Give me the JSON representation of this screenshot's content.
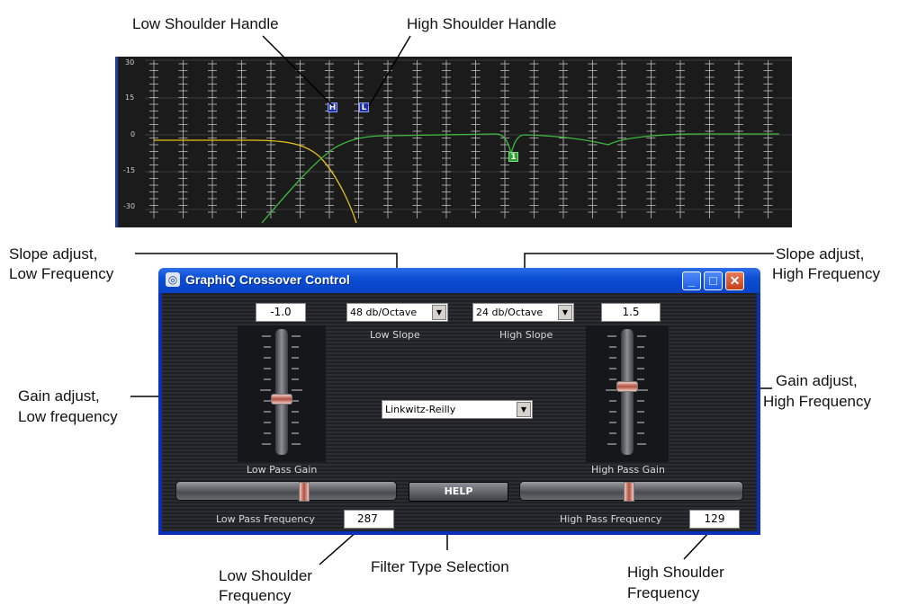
{
  "annotations": {
    "low_shoulder_handle": "Low Shoulder Handle",
    "high_shoulder_handle": "High Shoulder Handle",
    "slope_low_1": "Slope adjust,",
    "slope_low_2": "Low  Frequency",
    "slope_high_1": "Slope adjust,",
    "slope_high_2": "High  Frequency",
    "gain_low_1": "Gain adjust,",
    "gain_low_2": "Low  frequency",
    "gain_high_1": "Gain adjust,",
    "gain_high_2": "High  Frequency",
    "low_shoulder_freq_1": "Low Shoulder",
    "low_shoulder_freq_2": "Frequency",
    "filter_type": "Filter Type Selection",
    "high_shoulder_freq_1": "High Shoulder",
    "high_shoulder_freq_2": "Frequency"
  },
  "graph": {
    "y_labels": [
      "30",
      "15",
      "0",
      "-15",
      "-30"
    ],
    "handle_low": "H",
    "handle_high": "L",
    "marker_green": "1",
    "colors": {
      "background": "#1b1b1b",
      "grid": "#bdbdbd",
      "low_curve": "#e6c21a",
      "high_curve": "#3fb83f"
    }
  },
  "window": {
    "title": "GraphiQ Crossover Control",
    "controls": {
      "minimize": "_",
      "maximize": "□",
      "close": "✕"
    },
    "low_gain_value": "-1.0",
    "high_gain_value": "1.5",
    "low_slope": {
      "selected": "48 db/Octave",
      "label": "Low Slope"
    },
    "high_slope": {
      "selected": "24 db/Octave",
      "label": "High Slope"
    },
    "filter_type": {
      "selected": "Linkwitz-Reilly"
    },
    "low_pass_gain_label": "Low Pass Gain",
    "high_pass_gain_label": "High Pass Gain",
    "low_gain_level": 0.45,
    "high_gain_level": 0.57,
    "help_label": "HELP",
    "low_pass_freq_label": "Low Pass Frequency",
    "low_pass_freq_value": "287",
    "high_pass_freq_label": "High Pass Frequency",
    "high_pass_freq_value": "129",
    "low_freq_slider_level": 0.58,
    "high_freq_slider_level": 0.5
  },
  "colors": {
    "titlebar": "#0b4fd4",
    "frame": "#0a2fb8",
    "close_button": "#c5401d"
  }
}
